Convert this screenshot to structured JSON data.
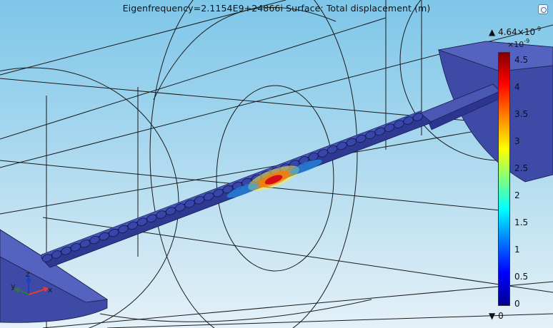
{
  "plot": {
    "title": "Eigenfrequency=2.1154E9+24866i   Surface: Total displacement (m)"
  },
  "colorbar": {
    "max_label": "4.64×10",
    "max_exponent": "-9",
    "multiplier": "×10",
    "multiplier_exponent": "-9",
    "min_label": "0",
    "up_arrow": "▲",
    "down_arrow": "▼",
    "ticks": [
      "4.5",
      "4",
      "3.5",
      "3",
      "2.5",
      "2",
      "1.5",
      "1",
      "0.5",
      "0"
    ],
    "colormap": [
      "#00008f",
      "#0000ff",
      "#0080ff",
      "#00ffff",
      "#80ff80",
      "#ffff00",
      "#ff8000",
      "#ff0000",
      "#800000"
    ]
  },
  "axes_triad": {
    "x_label": "x",
    "y_label": "y",
    "z_label": "z",
    "x_color": "#e53935",
    "y_color": "#2e7d32",
    "z_color": "#1e3fc4"
  },
  "colors": {
    "structure": "#3e4ea5",
    "structure_dark": "#262f7e",
    "wireframe": "#1a1a1a"
  },
  "icons": {
    "window": "view-window-icon"
  }
}
